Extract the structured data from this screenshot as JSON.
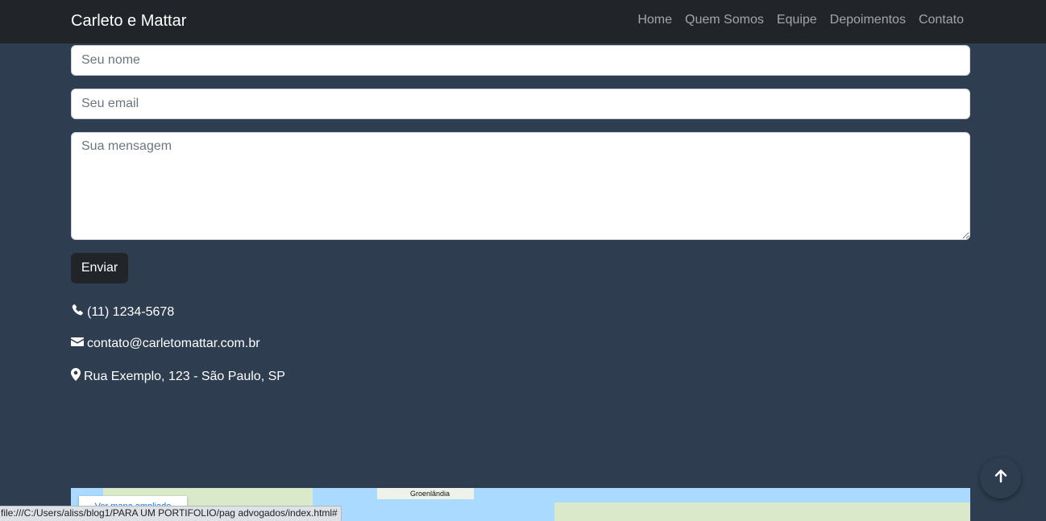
{
  "navbar": {
    "brand": "Carleto e Mattar",
    "links": [
      "Home",
      "Quem Somos",
      "Equipe",
      "Depoimentos",
      "Contato"
    ]
  },
  "form": {
    "name_placeholder": "Seu nome",
    "email_placeholder": "Seu email",
    "message_placeholder": "Sua mensagem",
    "submit_label": "Enviar"
  },
  "contact": {
    "phone": "(11) 1234-5678",
    "email": "contato@carletomattar.com.br",
    "address": "Rua Exemplo, 123 - São Paulo, SP",
    "phone_icon": "phone-icon",
    "email_icon": "envelope-icon",
    "address_icon": "map-marker-icon"
  },
  "map": {
    "view_larger_label": "Ver mapa ampliado",
    "place_label": "Groenlândia"
  },
  "status_bar": {
    "url": "file:///C:/Users/aliss/blog1/PARA UM PORTIFOLIO/pag advogados/index.html#"
  },
  "back_to_top": {
    "icon": "arrow-up-icon"
  },
  "colors": {
    "page_bg": "#2e3e50",
    "navbar_bg": "#212529",
    "button_bg": "#212529"
  }
}
